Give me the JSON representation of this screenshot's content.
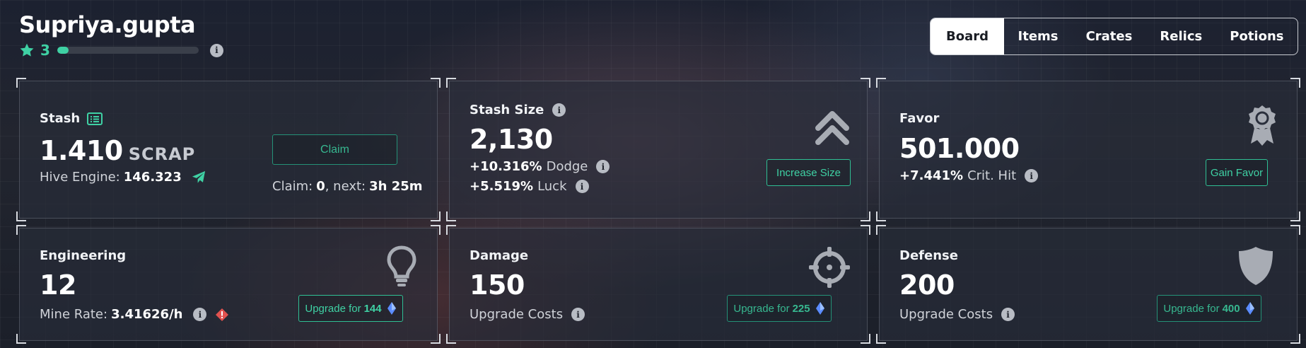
{
  "header": {
    "username": "Supriya.gupta",
    "level": "3",
    "xp_progress_percent": 8,
    "accent_color": "#3fd1a4"
  },
  "tabs": [
    {
      "label": "Board",
      "active": true
    },
    {
      "label": "Items",
      "active": false
    },
    {
      "label": "Crates",
      "active": false
    },
    {
      "label": "Relics",
      "active": false
    },
    {
      "label": "Potions",
      "active": false
    }
  ],
  "stash": {
    "title": "Stash",
    "value": "1.410",
    "unit": "SCRAP",
    "hive_label": "Hive Engine:",
    "hive_value": "146.323",
    "claim_button": "Claim",
    "claim_label": "Claim:",
    "claim_count": "0",
    "next_label": ", next:",
    "next_value": "3h 25m",
    "icons": [
      "list-icon",
      "paper-plane-icon"
    ]
  },
  "stash_size": {
    "title": "Stash Size",
    "value": "2,130",
    "dodge_pct": "+10.316%",
    "dodge_label": "Dodge",
    "luck_pct": "+5.519%",
    "luck_label": "Luck",
    "button": "Increase Size",
    "icon": "double-chevron-up-icon"
  },
  "favor": {
    "title": "Favor",
    "value": "501.000",
    "crit_pct": "+7.441%",
    "crit_label": "Crit. Hit",
    "button": "Gain Favor",
    "icon": "award-badge-icon"
  },
  "engineering": {
    "title": "Engineering",
    "value": "12",
    "rate_label": "Mine Rate:",
    "rate_value": "3.41626/h",
    "button_label": "Upgrade for",
    "button_cost": "144",
    "icon": "lightbulb-icon"
  },
  "damage": {
    "title": "Damage",
    "value": "150",
    "costs_label": "Upgrade Costs",
    "button_label": "Upgrade for",
    "button_cost": "225",
    "icon": "crosshair-icon"
  },
  "defense": {
    "title": "Defense",
    "value": "200",
    "costs_label": "Upgrade Costs",
    "button_label": "Upgrade for",
    "button_cost": "400",
    "icon": "shield-icon"
  }
}
